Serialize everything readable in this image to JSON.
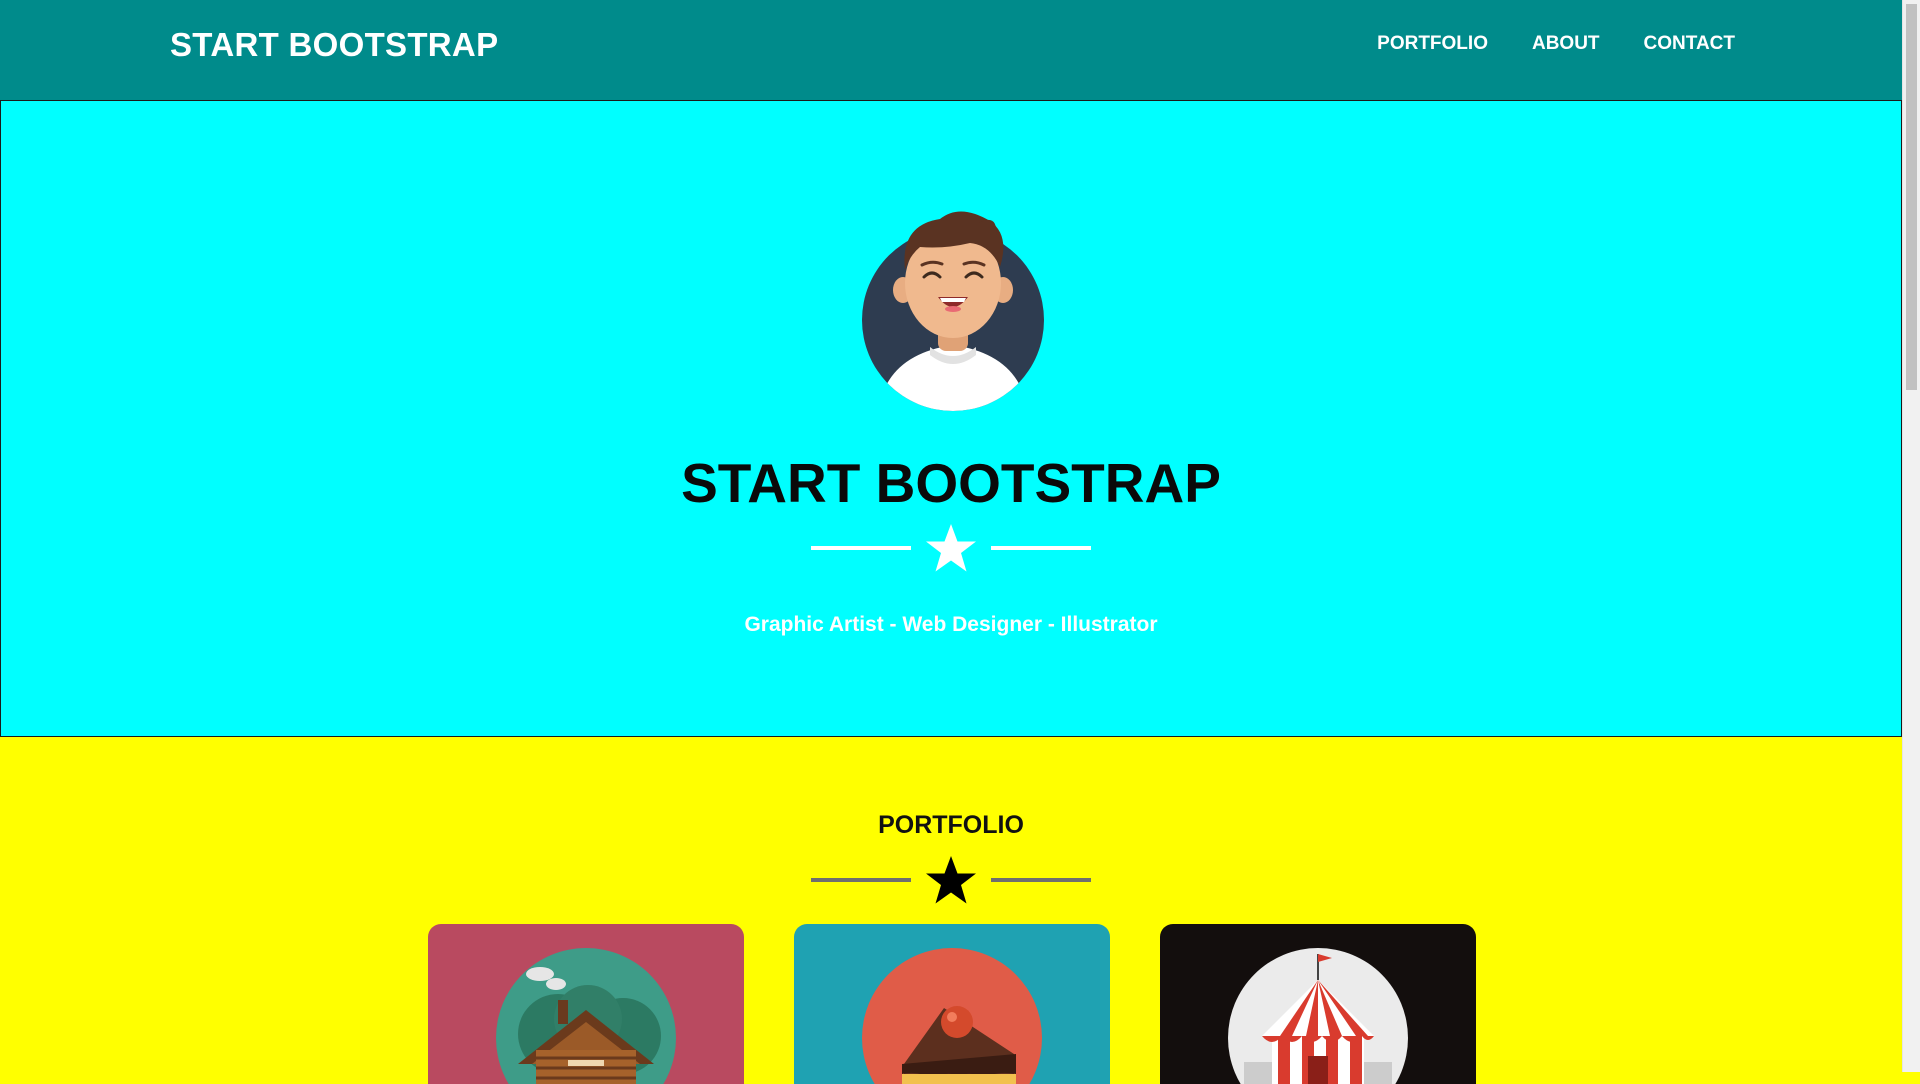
{
  "navbar": {
    "brand": "START BOOTSTRAP",
    "links": [
      "PORTFOLIO",
      "ABOUT",
      "CONTACT"
    ],
    "background": "#008b8b"
  },
  "hero": {
    "title": "START BOOTSTRAP",
    "subtitle": "Graphic Artist - Web Designer - Illustrator",
    "background": "#00ffff",
    "avatar_icon": "avatar-icon",
    "divider_icon": "star-icon"
  },
  "portfolio": {
    "title": "PORTFOLIO",
    "background": "#ffff00",
    "items": [
      {
        "icon": "cabin-icon",
        "color": "#b94a60"
      },
      {
        "icon": "cake-icon",
        "color": "#1fa2b2"
      },
      {
        "icon": "circus-tent-icon",
        "color": "#130e0d"
      }
    ]
  }
}
